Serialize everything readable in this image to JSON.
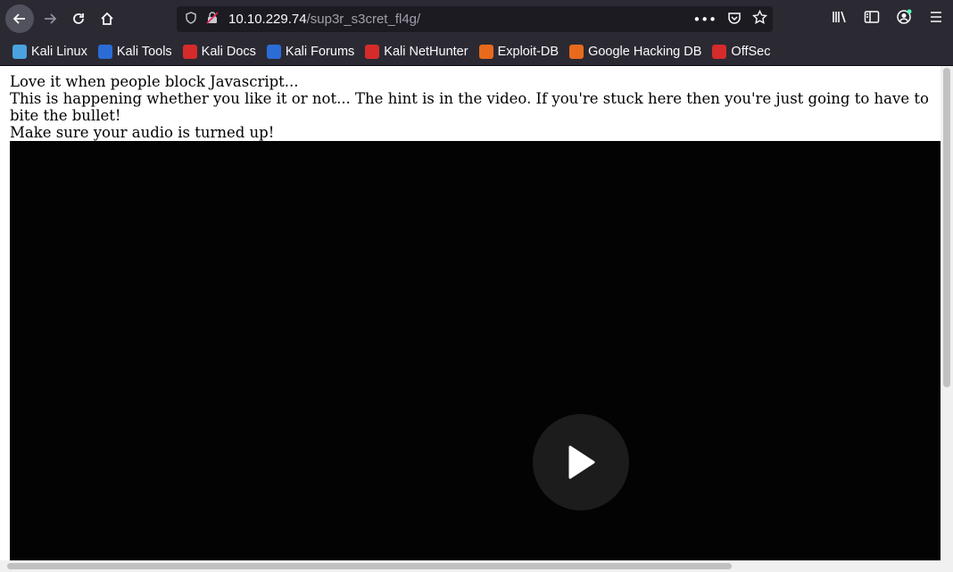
{
  "toolbar": {
    "back_icon": "arrow-left-icon",
    "forward_icon": "arrow-right-icon",
    "reload_icon": "reload-icon",
    "home_icon": "home-icon"
  },
  "urlbar": {
    "host": "10.10.229.74",
    "path": "/sup3r_s3cret_fl4g/"
  },
  "bookmarks": [
    {
      "label": "Kali Linux",
      "icon": "kali-dragon-icon",
      "color": "#4aa3df"
    },
    {
      "label": "Kali Tools",
      "icon": "kali-tools-icon",
      "color": "#2b6cd6"
    },
    {
      "label": "Kali Docs",
      "icon": "kali-docs-icon",
      "color": "#d62b2b"
    },
    {
      "label": "Kali Forums",
      "icon": "kali-forums-icon",
      "color": "#2b6cd6"
    },
    {
      "label": "Kali NetHunter",
      "icon": "nethunter-icon",
      "color": "#d62b2b"
    },
    {
      "label": "Exploit-DB",
      "icon": "exploit-db-icon",
      "color": "#e86a1c"
    },
    {
      "label": "Google Hacking DB",
      "icon": "ghdb-icon",
      "color": "#e86a1c"
    },
    {
      "label": "OffSec",
      "icon": "offsec-icon",
      "color": "#d62b2b"
    }
  ],
  "page": {
    "line1": "Love it when people block Javascript...",
    "line2": "This is happening whether you like it or not... The hint is in the video. If you're stuck here then you're just going to have to bite the bullet!",
    "line3": "Make sure your audio is turned up!"
  },
  "video": {
    "play_icon": "play-icon"
  }
}
